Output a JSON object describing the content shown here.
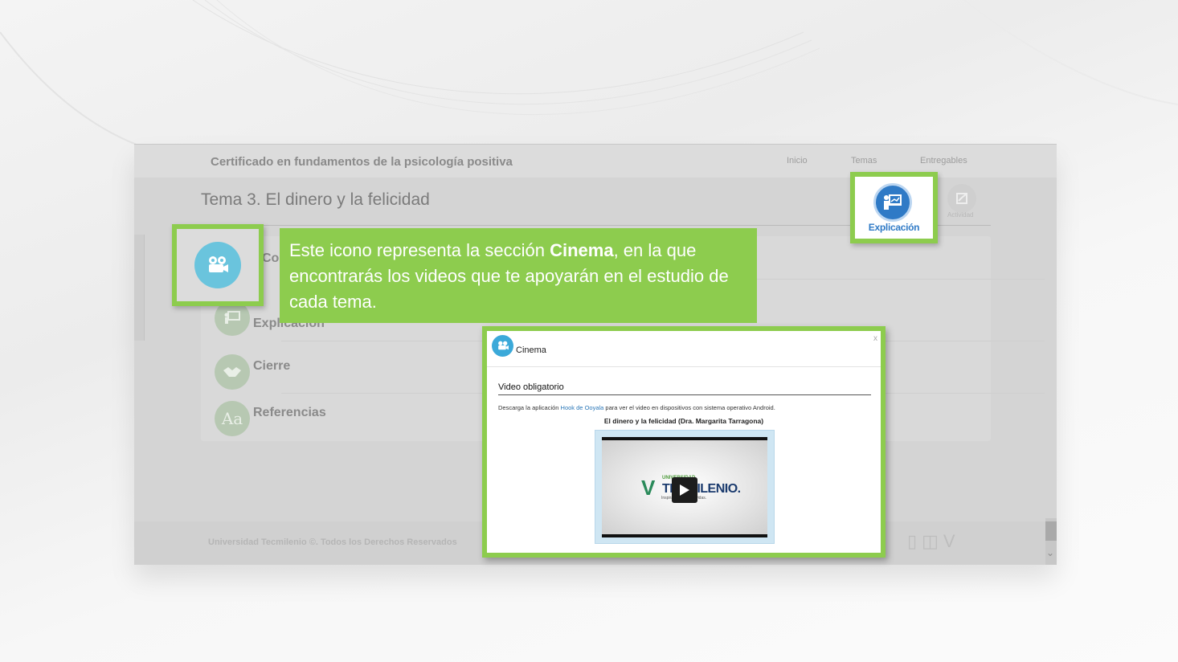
{
  "header": {
    "course_title": "Certificado en fundamentos de la psicología positiva",
    "nav": [
      "Inicio",
      "Temas",
      "Entregables"
    ]
  },
  "topic": {
    "title": "Tema 3. El dinero y la felicidad"
  },
  "menu": {
    "items": [
      {
        "label": "Cont",
        "icon": "cinema-icon"
      },
      {
        "label": "Explicación",
        "icon": "presentation-icon"
      },
      {
        "label": "Cierre",
        "icon": "handshake-icon"
      },
      {
        "label": "Referencias",
        "icon": "text-aa-icon",
        "glyph": "Aa"
      }
    ]
  },
  "explicacion_badge": {
    "label": "Explicación",
    "icon": "presentation-icon"
  },
  "actividad": {
    "label": "Actividad"
  },
  "callout": {
    "text_before": "Este icono representa la sección ",
    "bold": "Cinema",
    "text_after": ", en la que encontrarás los videos que te apoyarán en el estudio de cada tema."
  },
  "popup": {
    "title": "Cinema",
    "close": "x",
    "section_title": "Video obligatorio",
    "download_prefix": "Descarga la aplicación ",
    "download_link": "Hook de Ooyala",
    "download_suffix": " para ver el video en dispositivos con sistema operativo Android.",
    "video_title": "El dinero y la felicidad (Dra. Margarita Tarragona)",
    "video_logo_small": "UNIVERSIDAD",
    "video_logo": "TECMILENIO.",
    "video_tagline": "Inspira, transforma vidas."
  },
  "footer": {
    "text": "Universidad Tecmilenio ©. Todos los Derechos Reservados"
  },
  "colors": {
    "highlight_green": "#8dcc4e",
    "cinema_blue": "#6ac4dd",
    "explicacion_blue": "#2f7ac6"
  }
}
